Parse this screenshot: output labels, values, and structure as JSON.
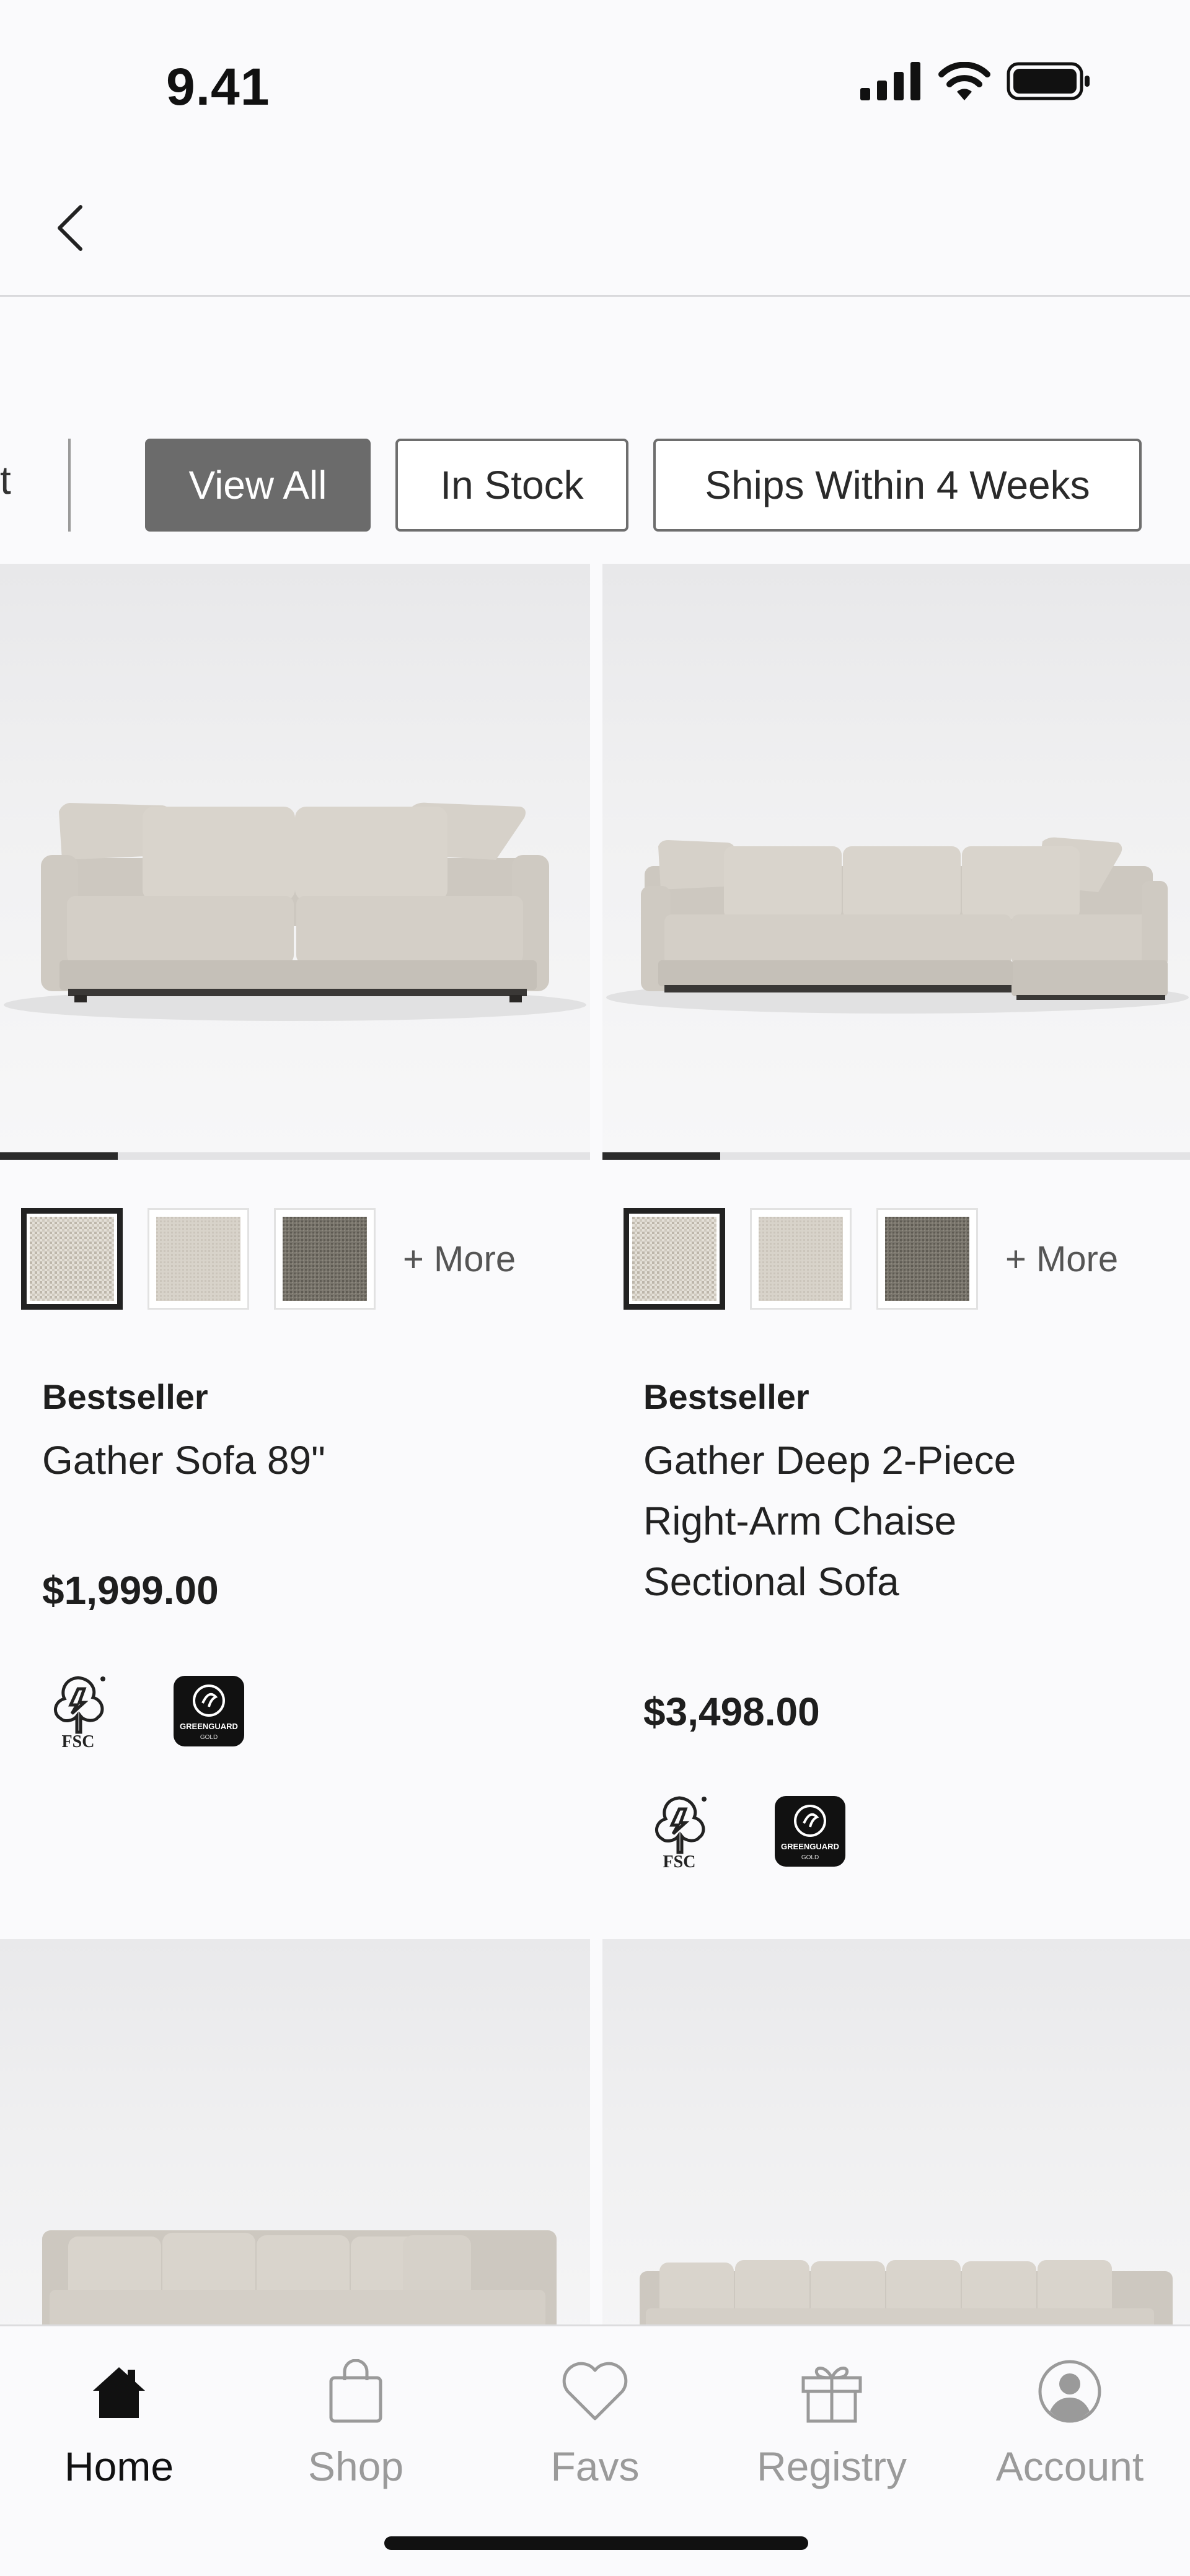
{
  "status_bar": {
    "time": "9.41",
    "icons": [
      "cellular-signal-icon",
      "wifi-icon",
      "battery-icon"
    ]
  },
  "nav": {
    "back_icon": "chevron-left-icon"
  },
  "filters": {
    "partial_label": "t",
    "chips": [
      {
        "label": "View All",
        "active": true
      },
      {
        "label": "In Stock",
        "active": false
      },
      {
        "label": "Ships Within 4 Weeks",
        "active": false
      }
    ]
  },
  "products": [
    {
      "badge": "Bestseller",
      "name": "Gather Sofa 89\"",
      "price": "$1,999.00",
      "more_label": "+ More",
      "image_progress": 0.2,
      "swatch_colors": [
        "#d9d4cb",
        "#d6d1c8",
        "#77736a"
      ],
      "certifications": [
        {
          "icon": "fsc-logo-icon",
          "text": "FSC"
        },
        {
          "icon": "greenguard-gold-icon",
          "text": "GREENGUARD"
        }
      ]
    },
    {
      "badge": "Bestseller",
      "name": "Gather Deep 2-Piece Right-Arm Chaise Sectional Sofa",
      "price": "$3,498.00",
      "more_label": "+ More",
      "image_progress": 0.2,
      "swatch_colors": [
        "#d9d4cb",
        "#d6d1c8",
        "#77736a"
      ],
      "certifications": [
        {
          "icon": "fsc-logo-icon",
          "text": "FSC"
        },
        {
          "icon": "greenguard-gold-icon",
          "text": "GREENGUARD"
        }
      ]
    }
  ],
  "tabbar": {
    "tabs": [
      {
        "label": "Home",
        "icon": "home-icon",
        "active": true
      },
      {
        "label": "Shop",
        "icon": "shopping-bag-icon",
        "active": false
      },
      {
        "label": "Favs",
        "icon": "heart-icon",
        "active": false
      },
      {
        "label": "Registry",
        "icon": "gift-icon",
        "active": false
      },
      {
        "label": "Account",
        "icon": "user-circle-icon",
        "active": false
      }
    ]
  },
  "colors": {
    "active_chip": "#6b6b6b",
    "text_primary": "#1e1e1e",
    "tab_inactive": "#9a9a9a",
    "background": "#fafafc"
  }
}
